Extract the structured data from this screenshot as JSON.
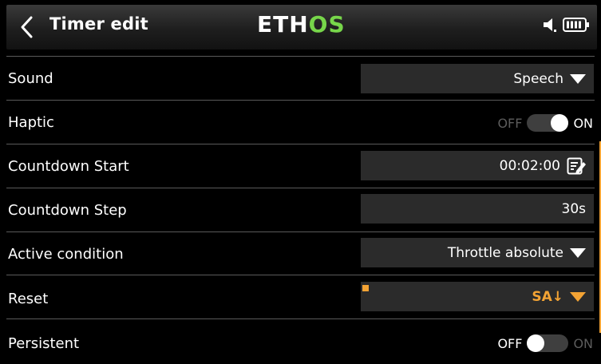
{
  "header": {
    "back_icon": "chevron-left-icon",
    "title": "Timer edit",
    "logo_part1": "ETH",
    "logo_part2": "OS",
    "logo_color_primary": "#ffffff",
    "logo_color_accent": "#77d64a",
    "status_icons": [
      "speaker-icon",
      "battery-icon"
    ]
  },
  "rows": {
    "sound": {
      "label": "Sound",
      "value": "Speech"
    },
    "haptic": {
      "label": "Haptic",
      "off_label": "OFF",
      "on_label": "ON",
      "state": "on"
    },
    "countdown_start": {
      "label": "Countdown Start",
      "value": "00:02:00",
      "icon": "edit-icon"
    },
    "countdown_step": {
      "label": "Countdown Step",
      "value": "30s"
    },
    "active_condition": {
      "label": "Active condition",
      "value": "Throttle absolute"
    },
    "reset": {
      "label": "Reset",
      "value": "SA↓",
      "focused": true
    },
    "persistent": {
      "label": "Persistent",
      "off_label": "OFF",
      "on_label": "ON",
      "state": "off"
    }
  },
  "colors": {
    "accent": "#f3a334",
    "field_bg": "#2b2b2b",
    "background": "#000000"
  }
}
